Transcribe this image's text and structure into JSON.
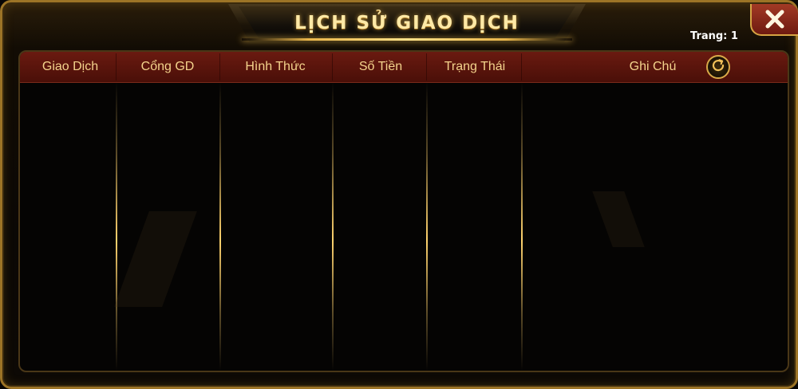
{
  "dialog": {
    "title": "LỊCH SỬ GIAO DỊCH",
    "page_label": "Trang: 1"
  },
  "table": {
    "columns": [
      "Giao Dịch",
      "Cổng GD",
      "Hình Thức",
      "Số Tiền",
      "Trạng Thái",
      "Ghi Chú"
    ],
    "rows": []
  },
  "icons": {
    "close": "close-icon",
    "refresh": "refresh-icon"
  },
  "colors": {
    "accent_gold": "#e8b54a",
    "header_red": "#5a140c",
    "header_text": "#f4d38c",
    "close_red": "#8a2a1a"
  }
}
